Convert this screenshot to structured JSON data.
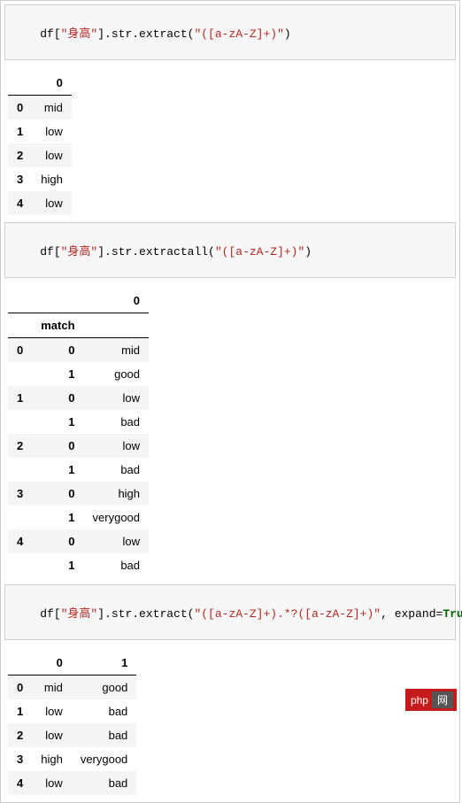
{
  "cells": [
    {
      "code_segments": [
        {
          "text": "df[",
          "cls": "code-plain"
        },
        {
          "text": "\"身高\"",
          "cls": "code-str"
        },
        {
          "text": "].str.extract(",
          "cls": "code-plain"
        },
        {
          "text": "\"([a-zA-Z]+)\"",
          "cls": "code-str"
        },
        {
          "text": ")",
          "cls": "code-plain"
        }
      ],
      "table": {
        "columns": [
          "0"
        ],
        "index": [
          "0",
          "1",
          "2",
          "3",
          "4"
        ],
        "rows": [
          [
            "mid"
          ],
          [
            "low"
          ],
          [
            "low"
          ],
          [
            "high"
          ],
          [
            "low"
          ]
        ]
      }
    },
    {
      "code_segments": [
        {
          "text": "df[",
          "cls": "code-plain"
        },
        {
          "text": "\"身高\"",
          "cls": "code-str"
        },
        {
          "text": "].str.extractall(",
          "cls": "code-plain"
        },
        {
          "text": "\"([a-zA-Z]+)\"",
          "cls": "code-str"
        },
        {
          "text": ")",
          "cls": "code-plain"
        }
      ],
      "table_multi": {
        "columns": [
          "0"
        ],
        "index_names": [
          "",
          "match"
        ],
        "rows": [
          {
            "i0": "0",
            "i1": "0",
            "v": [
              "mid"
            ]
          },
          {
            "i0": "",
            "i1": "1",
            "v": [
              "good"
            ]
          },
          {
            "i0": "1",
            "i1": "0",
            "v": [
              "low"
            ]
          },
          {
            "i0": "",
            "i1": "1",
            "v": [
              "bad"
            ]
          },
          {
            "i0": "2",
            "i1": "0",
            "v": [
              "low"
            ]
          },
          {
            "i0": "",
            "i1": "1",
            "v": [
              "bad"
            ]
          },
          {
            "i0": "3",
            "i1": "0",
            "v": [
              "high"
            ]
          },
          {
            "i0": "",
            "i1": "1",
            "v": [
              "verygood"
            ]
          },
          {
            "i0": "4",
            "i1": "0",
            "v": [
              "low"
            ]
          },
          {
            "i0": "",
            "i1": "1",
            "v": [
              "bad"
            ]
          }
        ]
      }
    },
    {
      "code_segments": [
        {
          "text": "df[",
          "cls": "code-plain"
        },
        {
          "text": "\"身高\"",
          "cls": "code-str"
        },
        {
          "text": "].str.extract(",
          "cls": "code-plain"
        },
        {
          "text": "\"([a-zA-Z]+).*?([a-zA-Z]+)\"",
          "cls": "code-str"
        },
        {
          "text": ", expand=",
          "cls": "code-param"
        },
        {
          "text": "True",
          "cls": "code-true"
        },
        {
          "text": ")",
          "cls": "code-plain"
        }
      ],
      "table": {
        "columns": [
          "0",
          "1"
        ],
        "index": [
          "0",
          "1",
          "2",
          "3",
          "4"
        ],
        "rows": [
          [
            "mid",
            "good"
          ],
          [
            "low",
            "bad"
          ],
          [
            "low",
            "bad"
          ],
          [
            "high",
            "verygood"
          ],
          [
            "low",
            "bad"
          ]
        ]
      }
    }
  ],
  "logo": {
    "text_left": "php",
    "text_right": "网"
  }
}
